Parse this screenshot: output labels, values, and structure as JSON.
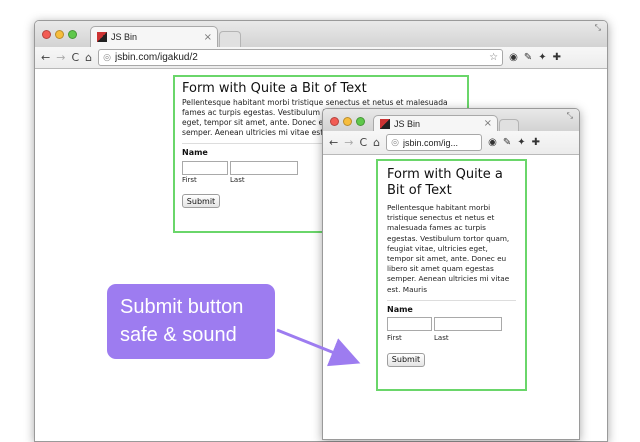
{
  "colors": {
    "callout": "#9d7cf0",
    "form_border": "#6ad66a"
  },
  "back_window": {
    "tab_title": "JS Bin",
    "url": "jsbin.com/igakud/2",
    "form": {
      "title": "Form with Quite a Bit of Text",
      "body": "Pellentesque habitant morbi tristique senectus et netus et malesuada fames ac turpis egestas. Vestibulum tortor quam, feugiat vitae, ultricies eget, tempor sit amet, ante. Donec eu libero sit amet quam egestas semper. Aenean ultricies mi vitae est. Mauris",
      "name_label": "Name",
      "first_label": "First",
      "last_label": "Last",
      "submit_label": "Submit"
    }
  },
  "front_window": {
    "tab_title": "JS Bin",
    "url": "jsbin.com/ig...",
    "form": {
      "title": "Form with Quite a Bit of Text",
      "body": "Pellentesque habitant morbi tristique senectus et netus et malesuada fames ac turpis egestas. Vestibulum tortor quam, feugiat vitae, ultricies eget, tempor sit amet, ante. Donec eu libero sit amet quam egestas semper. Aenean ultricies mi vitae est. Mauris",
      "name_label": "Name",
      "first_label": "First",
      "last_label": "Last",
      "submit_label": "Submit"
    }
  },
  "callout": {
    "line1": "Submit button",
    "line2": "safe & sound"
  },
  "icons": {
    "close": "×",
    "back": "←",
    "forward": "→",
    "reload": "C",
    "home": "⌂",
    "globe": "◎",
    "star": "☆",
    "ext1": "◉",
    "ext2": "✎",
    "ext3": "✦",
    "wrench": "✚",
    "resize": "⤡"
  }
}
